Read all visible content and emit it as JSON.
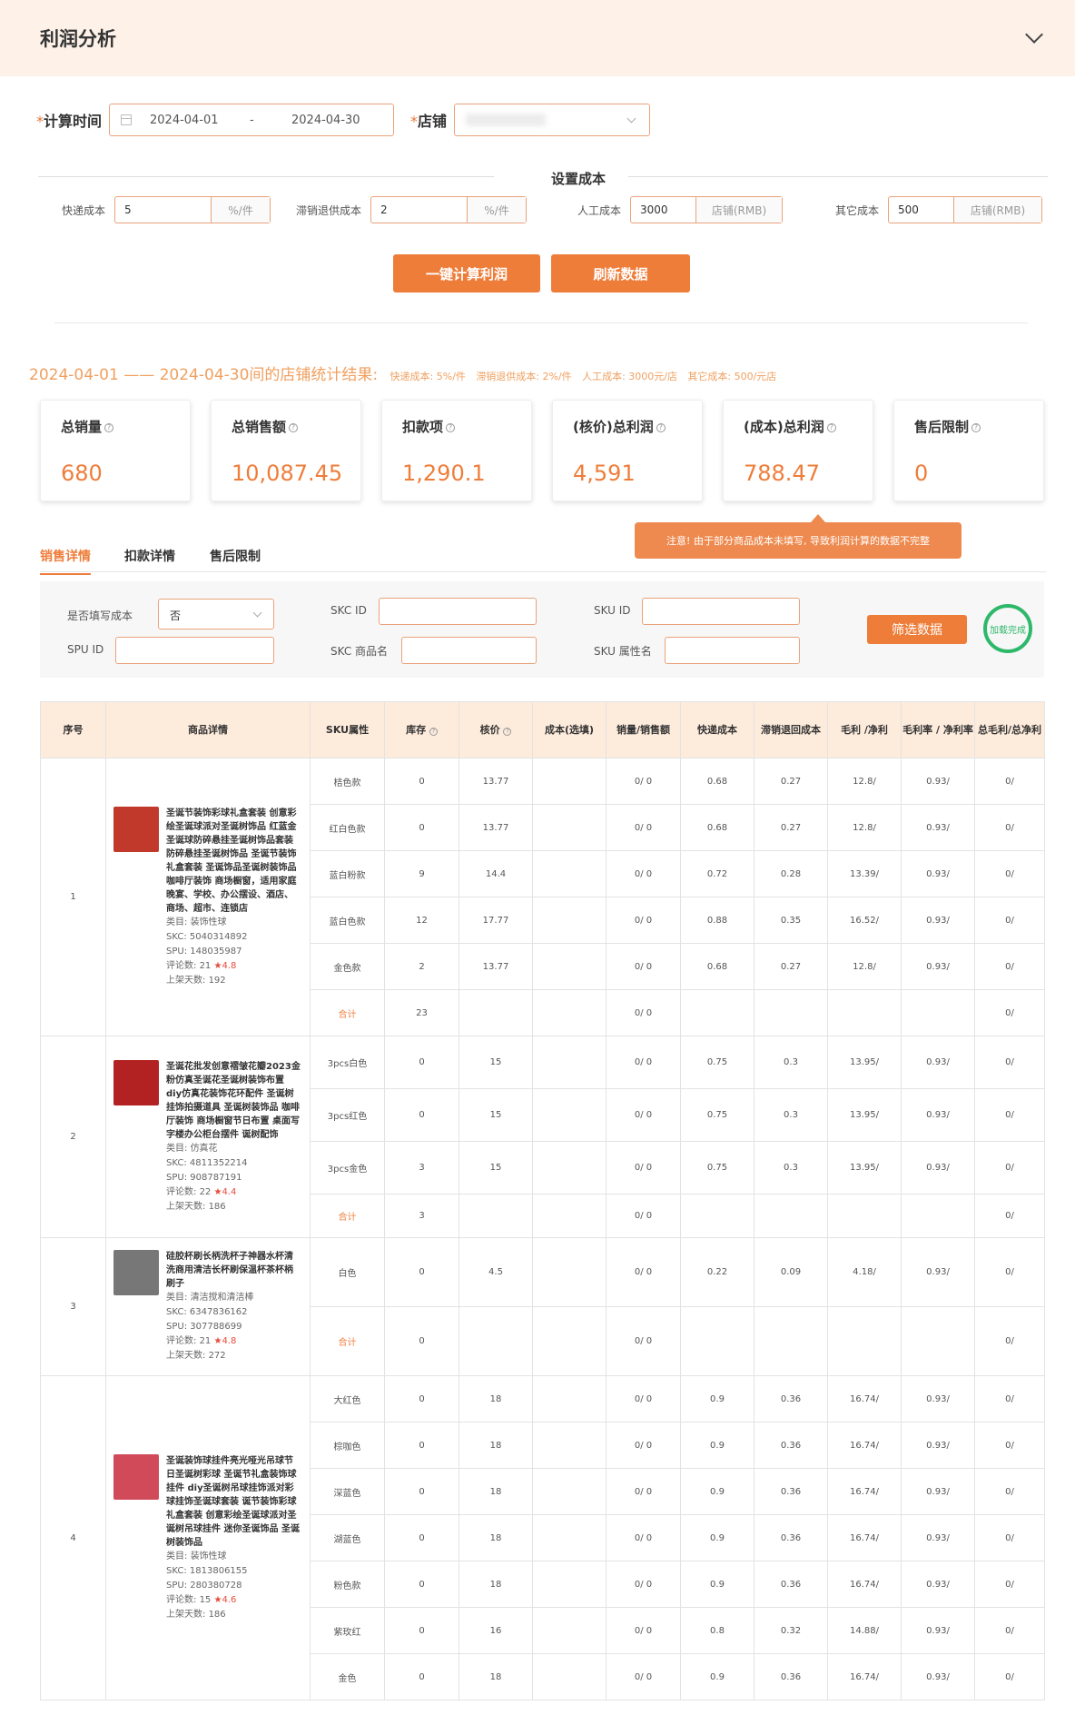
{
  "header": {
    "title": "利润分析"
  },
  "calc_time": {
    "label": "计算时间",
    "start": "2024-04-01",
    "sep": "-",
    "end": "2024-04-30"
  },
  "store": {
    "label": "店铺"
  },
  "costs": {
    "title": "设置成本",
    "items": [
      {
        "label": "快递成本",
        "value": "5",
        "unit": "%/件"
      },
      {
        "label": "滞销退供成本",
        "value": "2",
        "unit": "%/件"
      },
      {
        "label": "人工成本",
        "value": "3000",
        "unit": "店铺(RMB)"
      },
      {
        "label": "其它成本",
        "value": "500",
        "unit": "店铺(RMB)"
      }
    ]
  },
  "buttons": {
    "calc": "一键计算利润",
    "refresh": "刷新数据"
  },
  "result": {
    "main": "2024-04-01 —— 2024-04-30间的店铺统计结果:",
    "details": [
      "快递成本: 5%/件",
      "滞销退供成本: 2%/件",
      "人工成本: 3000元/店",
      "其它成本: 500/元店"
    ]
  },
  "cards": [
    {
      "title": "总销量",
      "value": "680"
    },
    {
      "title": "总销售额",
      "value": "10,087.45"
    },
    {
      "title": "扣款项",
      "value": "1,290.1"
    },
    {
      "title": "(核价)总利润",
      "value": "4,591"
    },
    {
      "title": "(成本)总利润",
      "value": "788.47"
    },
    {
      "title": "售后限制",
      "value": "0"
    }
  ],
  "tip": "注意! 由于部分商品成本未填写, 导致利润计算的数据不完整",
  "tabs": [
    "销售详情",
    "扣款详情",
    "售后限制"
  ],
  "filter": {
    "cost_filled_label": "是否填写成本",
    "cost_filled_value": "否",
    "skc_id_label": "SKC ID",
    "sku_id_label": "SKU ID",
    "spu_id_label": "SPU ID",
    "skc_name_label": "SKC 商品名",
    "sku_attr_label": "SKU 属性名",
    "button": "筛选数据",
    "status": "加载完成"
  },
  "table": {
    "headers": [
      "序号",
      "商品详情",
      "SKU属性",
      "库存",
      "核价",
      "成本(选填)",
      "销量/销售额",
      "快递成本",
      "滞销退回成本",
      "毛利 /净利",
      "毛利率 / 净利率",
      "总毛利/总净利"
    ],
    "meta_labels": {
      "cat": "类目: ",
      "skc": "SKC: ",
      "spu": "SPU: ",
      "reviews": "评论数: ",
      "days": "上架天数: "
    },
    "total_label": "合计",
    "products": [
      {
        "idx": "1",
        "name": "圣诞节装饰彩球礼盒套装 创意彩绘圣诞球派对圣诞树饰品 红蓝金圣诞球防碎悬挂圣诞树饰品套装 防碎悬挂圣诞树饰品 圣诞节装饰礼盒套装 圣诞饰品圣诞树装饰品 咖啡厅装饰 商场橱窗，适用家庭晚宴、学校、办公摆设、酒店、商场、超市、连锁店",
        "cat": "装饰性球",
        "skc": "5040314892",
        "spu": "148035987",
        "reviews": "21",
        "rating": "★4.8",
        "days": "192",
        "color": "#c0392b",
        "skus": [
          [
            "桔色款",
            "0",
            "13.77",
            "",
            "0/ 0",
            "0.68",
            "0.27",
            "12.8/",
            "0.93/",
            "0/"
          ],
          [
            "红白色款",
            "0",
            "13.77",
            "",
            "0/ 0",
            "0.68",
            "0.27",
            "12.8/",
            "0.93/",
            "0/"
          ],
          [
            "蓝白粉款",
            "9",
            "14.4",
            "",
            "0/ 0",
            "0.72",
            "0.28",
            "13.39/",
            "0.93/",
            "0/"
          ],
          [
            "蓝白色款",
            "12",
            "17.77",
            "",
            "0/ 0",
            "0.88",
            "0.35",
            "16.52/",
            "0.93/",
            "0/"
          ],
          [
            "金色款",
            "2",
            "13.77",
            "",
            "0/ 0",
            "0.68",
            "0.27",
            "12.8/",
            "0.93/",
            "0/"
          ]
        ],
        "total": [
          "23",
          "0/ 0",
          "0/"
        ]
      },
      {
        "idx": "2",
        "name": "圣诞花批发创意褶皱花瓣2023金粉仿真圣诞花圣诞树装饰布置 diy仿真花装饰花环配件 圣诞树挂饰拍摄道具 圣诞树装饰品 咖啡厅装饰 商场橱窗节日布置 桌面写字楼办公柜台摆件 诞树配饰",
        "cat": "仿真花",
        "skc": "4811352214",
        "spu": "908787191",
        "reviews": "22",
        "rating": "★4.4",
        "days": "186",
        "color": "#b22222",
        "skus": [
          [
            "3pcs白色",
            "0",
            "15",
            "",
            "0/ 0",
            "0.75",
            "0.3",
            "13.95/",
            "0.93/",
            "0/"
          ],
          [
            "3pcs红色",
            "0",
            "15",
            "",
            "0/ 0",
            "0.75",
            "0.3",
            "13.95/",
            "0.93/",
            "0/"
          ],
          [
            "3pcs金色",
            "3",
            "15",
            "",
            "0/ 0",
            "0.75",
            "0.3",
            "13.95/",
            "0.93/",
            "0/"
          ]
        ],
        "total": [
          "3",
          "0/ 0",
          "0/"
        ]
      },
      {
        "idx": "3",
        "name": "硅胶杯刷长柄洗杯子神器水杯清洗商用清洁长杯刷保温杯茶杯柄刷子",
        "cat": "清洁搅和清洁棒",
        "skc": "6347836162",
        "spu": "307788699",
        "reviews": "21",
        "rating": "★4.8",
        "days": "272",
        "color": "#777777",
        "skus": [
          [
            "白色",
            "0",
            "4.5",
            "",
            "0/ 0",
            "0.22",
            "0.09",
            "4.18/",
            "0.93/",
            "0/"
          ]
        ],
        "total": [
          "0",
          "0/ 0",
          "0/"
        ]
      },
      {
        "idx": "4",
        "name": "圣诞装饰球挂件亮光哑光吊球节日圣诞树彩球 圣诞节礼盒装饰球挂件 diy圣诞树吊球挂饰派对彩球挂饰圣诞球套装 诞节装饰彩球礼盒套装 创意彩绘圣诞球派对圣诞树吊球挂件 迷你圣诞饰品 圣诞树装饰品",
        "cat": "装饰性球",
        "skc": "1813806155",
        "spu": "280380728",
        "reviews": "15",
        "rating": "★4.6",
        "days": "186",
        "color": "#d04a5a",
        "skus": [
          [
            "大红色",
            "0",
            "18",
            "",
            "0/ 0",
            "0.9",
            "0.36",
            "16.74/",
            "0.93/",
            "0/"
          ],
          [
            "棕咖色",
            "0",
            "18",
            "",
            "0/ 0",
            "0.9",
            "0.36",
            "16.74/",
            "0.93/",
            "0/"
          ],
          [
            "深蓝色",
            "0",
            "18",
            "",
            "0/ 0",
            "0.9",
            "0.36",
            "16.74/",
            "0.93/",
            "0/"
          ],
          [
            "湖蓝色",
            "0",
            "18",
            "",
            "0/ 0",
            "0.9",
            "0.36",
            "16.74/",
            "0.93/",
            "0/"
          ],
          [
            "粉色款",
            "0",
            "18",
            "",
            "0/ 0",
            "0.9",
            "0.36",
            "16.74/",
            "0.93/",
            "0/"
          ],
          [
            "紫玫红",
            "0",
            "16",
            "",
            "0/ 0",
            "0.8",
            "0.32",
            "14.88/",
            "0.93/",
            "0/"
          ],
          [
            "金色",
            "0",
            "18",
            "",
            "0/ 0",
            "0.9",
            "0.36",
            "16.74/",
            "0.93/",
            "0/"
          ]
        ],
        "total": null
      }
    ]
  }
}
